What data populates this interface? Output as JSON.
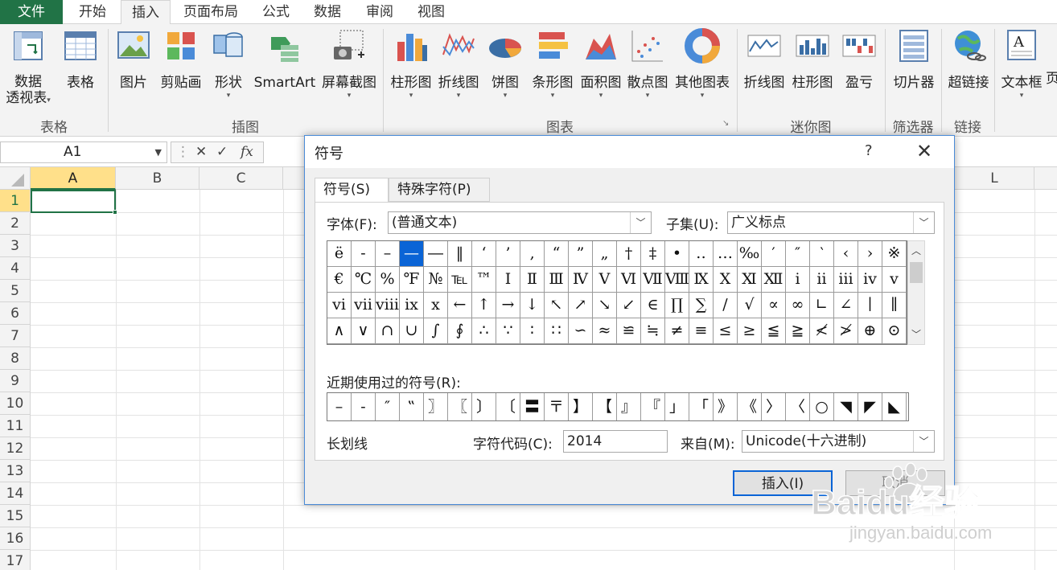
{
  "tabs": [
    "文件",
    "开始",
    "插入",
    "页面布局",
    "公式",
    "数据",
    "审阅",
    "视图"
  ],
  "ribbon": {
    "buttons": [
      {
        "label": "数据",
        "label2": "透视表",
        "dd": "▾"
      },
      {
        "label": "表格"
      },
      {
        "label": "图片"
      },
      {
        "label": "剪贴画"
      },
      {
        "label": "形状",
        "dd": "▾"
      },
      {
        "label": "SmartArt"
      },
      {
        "label": "屏幕截图",
        "dd": "▾"
      },
      {
        "label": "柱形图",
        "dd": "▾"
      },
      {
        "label": "折线图",
        "dd": "▾"
      },
      {
        "label": "饼图",
        "dd": "▾"
      },
      {
        "label": "条形图",
        "dd": "▾"
      },
      {
        "label": "面积图",
        "dd": "▾"
      },
      {
        "label": "散点图",
        "dd": "▾"
      },
      {
        "label": "其他图表",
        "dd": "▾"
      },
      {
        "label": "折线图"
      },
      {
        "label": "柱形图"
      },
      {
        "label": "盈亏"
      },
      {
        "label": "切片器"
      },
      {
        "label": "超链接"
      },
      {
        "label": "文本框",
        "dd": "▾"
      },
      {
        "label": "页"
      }
    ],
    "groups": [
      "表格",
      "插图",
      "图表",
      "迷你图",
      "筛选器",
      "链接"
    ]
  },
  "formula_bar": {
    "cell_ref": "A1",
    "cancel": "✕",
    "enter": "✓",
    "fx": "fx"
  },
  "sheet": {
    "columns": [
      "A",
      "B",
      "C",
      "L"
    ],
    "rows": [
      "1",
      "2",
      "3",
      "4",
      "5",
      "6",
      "7",
      "8",
      "9",
      "10",
      "11",
      "12",
      "13",
      "14",
      "15",
      "16",
      "17"
    ]
  },
  "dialog": {
    "title": "符号",
    "help": "?",
    "close": "✕",
    "tabs": [
      "符号(S)",
      "特殊字符(P)"
    ],
    "font_label": "字体(F):",
    "font_value": "(普通文本)",
    "subset_label": "子集(U):",
    "subset_value": "广义标点",
    "symbols": [
      [
        "ë",
        "‐",
        "–",
        "—",
        "―",
        "‖",
        "‘",
        "’",
        "‚",
        "“",
        "”",
        "„",
        "†",
        "‡",
        "•",
        "‥",
        "…",
        "‰",
        "′",
        "″",
        "‵",
        "‹",
        "›",
        "※"
      ],
      [
        "€",
        "℃",
        "%",
        "℉",
        "№",
        "℡",
        "™",
        "Ⅰ",
        "Ⅱ",
        "Ⅲ",
        "Ⅳ",
        "Ⅴ",
        "Ⅵ",
        "Ⅶ",
        "Ⅷ",
        "Ⅸ",
        "Ⅹ",
        "Ⅺ",
        "Ⅻ",
        "ⅰ",
        "ⅱ",
        "ⅲ",
        "ⅳ",
        "ⅴ"
      ],
      [
        "ⅵ",
        "ⅶ",
        "ⅷ",
        "ⅸ",
        "ⅹ",
        "←",
        "↑",
        "→",
        "↓",
        "↖",
        "↗",
        "↘",
        "↙",
        "∈",
        "∏",
        "∑",
        "∕",
        "√",
        "∝",
        "∞",
        "∟",
        "∠",
        "∣",
        "∥"
      ],
      [
        "∧",
        "∨",
        "∩",
        "∪",
        "∫",
        "∮",
        "∴",
        "∵",
        "∶",
        "∷",
        "∽",
        "≈",
        "≌",
        "≒",
        "≠",
        "≡",
        "≤",
        "≥",
        "≦",
        "≧",
        "≮",
        "≯",
        "⊕",
        "⊙"
      ]
    ],
    "selected_symbol": "—",
    "recent_label": "近期使用过的符号(R):",
    "recent": [
      "–",
      "‐",
      "″",
      "‟",
      "〗",
      "〖",
      "〕",
      "〔",
      "〓",
      "〒",
      "】",
      "【",
      "』",
      "『",
      "」",
      "「",
      "》",
      "《",
      "〉",
      "〈",
      "○",
      "◥",
      "◤",
      "◣"
    ],
    "char_name": "长划线",
    "code_label": "字符代码(C):",
    "code_value": "2014",
    "from_label": "来自(M):",
    "from_value": "Unicode(十六进制)",
    "insert_button": "插入(I)",
    "cancel_button": "取消"
  },
  "watermark": {
    "brand": "Baidu经验",
    "url": "jingyan.baidu.com"
  },
  "colors": {
    "excel_green": "#217346",
    "selection_blue": "#0a64d6",
    "header_highlight": "#ffe08a"
  }
}
